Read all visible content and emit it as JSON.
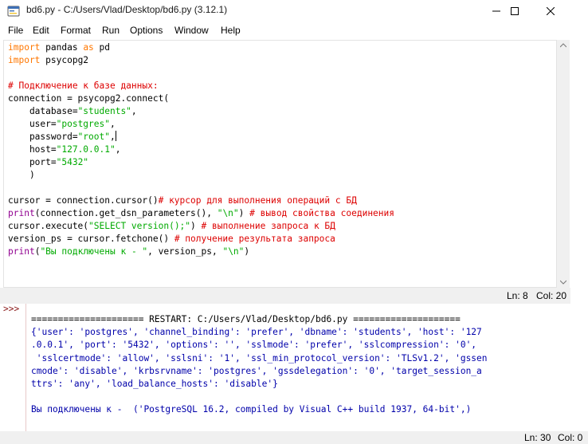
{
  "window": {
    "title": "bd6.py - C:/Users/Vlad/Desktop/bd6.py (3.12.1)",
    "icon": "idle-python-icon",
    "controls": [
      "minimize-icon",
      "maximize-icon",
      "close-icon"
    ]
  },
  "menu": [
    "File",
    "Edit",
    "Format",
    "Run",
    "Options",
    "Window",
    "Help"
  ],
  "editor": {
    "lines": [
      [
        {
          "t": "import",
          "c": "kw"
        },
        {
          "t": " pandas "
        },
        {
          "t": "as",
          "c": "kw"
        },
        {
          "t": " pd"
        }
      ],
      [
        {
          "t": "import",
          "c": "kw"
        },
        {
          "t": " psycopg2"
        }
      ],
      [],
      [
        {
          "t": "# Подключение к базе данных:",
          "c": "cm"
        }
      ],
      [
        {
          "t": "connection = psycopg2.connect("
        }
      ],
      [
        {
          "t": "    database="
        },
        {
          "t": "\"students\"",
          "c": "str"
        },
        {
          "t": ","
        }
      ],
      [
        {
          "t": "    user="
        },
        {
          "t": "\"postgres\"",
          "c": "str"
        },
        {
          "t": ","
        }
      ],
      [
        {
          "t": "    password="
        },
        {
          "t": "\"root\"",
          "c": "str"
        },
        {
          "t": ","
        },
        {
          "cursor": true
        }
      ],
      [
        {
          "t": "    host="
        },
        {
          "t": "\"127.0.0.1\"",
          "c": "str"
        },
        {
          "t": ","
        }
      ],
      [
        {
          "t": "    port="
        },
        {
          "t": "\"5432\"",
          "c": "str"
        }
      ],
      [
        {
          "t": "    )"
        }
      ],
      [],
      [
        {
          "t": "cursor = connection.cursor()"
        },
        {
          "t": "# курсор для выполнения операций с БД",
          "c": "cm"
        }
      ],
      [
        {
          "t": "print",
          "c": "bi"
        },
        {
          "t": "(connection.get_dsn_parameters(), "
        },
        {
          "t": "\"\\n\"",
          "c": "str"
        },
        {
          "t": ") "
        },
        {
          "t": "# вывод свойства соединения",
          "c": "cm"
        }
      ],
      [
        {
          "t": "cursor.execute("
        },
        {
          "t": "\"SELECT version();\"",
          "c": "str"
        },
        {
          "t": ") "
        },
        {
          "t": "# выполнение запроса к БД",
          "c": "cm"
        }
      ],
      [
        {
          "t": "version_ps = cursor.fetchone() "
        },
        {
          "t": "# получение результата запроса",
          "c": "cm"
        }
      ],
      [
        {
          "t": "print",
          "c": "bi"
        },
        {
          "t": "("
        },
        {
          "t": "\"Вы подключены к - \"",
          "c": "str"
        },
        {
          "t": ", version_ps, "
        },
        {
          "t": "\"\\n\"",
          "c": "str"
        },
        {
          "t": ")"
        }
      ]
    ],
    "status": {
      "ln": "Ln: 8",
      "col": "Col: 20"
    }
  },
  "shell": {
    "prompt": ">>>",
    "lines": [
      {
        "t": "===================== RESTART: C:/Users/Vlad/Desktop/bd6.py ====================",
        "c": "restart"
      },
      {
        "t": "{'user': 'postgres', 'channel_binding': 'prefer', 'dbname': 'students', 'host': '127",
        "c": "out"
      },
      {
        "t": ".0.0.1', 'port': '5432', 'options': '', 'sslmode': 'prefer', 'sslcompression': '0',",
        "c": "out"
      },
      {
        "t": " 'sslcertmode': 'allow', 'sslsni': '1', 'ssl_min_protocol_version': 'TLSv1.2', 'gssen",
        "c": "out"
      },
      {
        "t": "cmode': 'disable', 'krbsrvname': 'postgres', 'gssdelegation': '0', 'target_session_a",
        "c": "out"
      },
      {
        "t": "ttrs': 'any', 'load_balance_hosts': 'disable'}",
        "c": "out"
      },
      {
        "t": "",
        "c": "out"
      },
      {
        "t": "Вы подключены к -  ('PostgreSQL 16.2, compiled by Visual C++ build 1937, 64-bit',)",
        "c": "out"
      }
    ],
    "status": {
      "ln": "Ln: 30",
      "col": "Col: 0"
    }
  }
}
